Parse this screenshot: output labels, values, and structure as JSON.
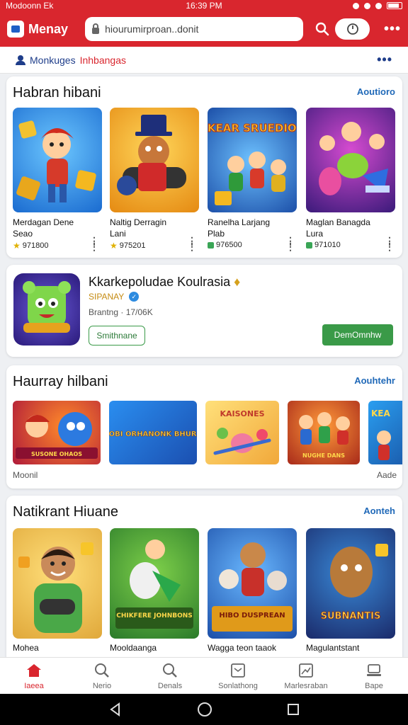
{
  "status_bar": {
    "carrier": "Modoonn Ek",
    "time": "16:39 PM"
  },
  "app_bar": {
    "logo_text": "Menay",
    "url": "hiourumirproan..donit"
  },
  "sub_bar": {
    "link_primary": "Monkuges",
    "link_secondary": "Inhbangas"
  },
  "section1": {
    "title": "Habran hibani",
    "link": "Aoutioro",
    "items": [
      {
        "line1": "Merdagan Dene",
        "line2": "Seao",
        "meta": "971800",
        "badge": "star"
      },
      {
        "line1": "Naltig Derragin",
        "line2": "Lani",
        "meta": "975201",
        "badge": "star"
      },
      {
        "line1": "Ranelha Larjang",
        "line2": "Plab",
        "meta": "976500",
        "badge": "green"
      },
      {
        "line1": "Maglan Banagda",
        "line2": "Lura",
        "meta": "971010",
        "badge": "green"
      }
    ],
    "art": [
      {
        "label": ""
      },
      {
        "label": ""
      },
      {
        "label": "EAKEAR SRUEDIORS"
      },
      {
        "label": ""
      }
    ]
  },
  "featured": {
    "title": "Kkarkepoludae Koulrasia",
    "developer": "SIPANAY",
    "stats": "Brantng · 17/06K",
    "secondary_button": "Smithnane",
    "primary_button": "DemOmnhw"
  },
  "section2": {
    "title": "Haurray hilbani",
    "link": "Aouhtehr",
    "banners": [
      {
        "text": "SUSONE OHAOS"
      },
      {
        "text": "LENOBI ORHANONK BHURDES"
      },
      {
        "text": "KAISONES"
      },
      {
        "text": "NUGHE DANS"
      },
      {
        "text": "KEA"
      }
    ],
    "footer_left": "Moonil",
    "footer_right": "Aade"
  },
  "section3": {
    "title": "Natikrant Hiuane",
    "link": "Aonteh",
    "items": [
      {
        "name": "Mohea",
        "art": ""
      },
      {
        "name": "Mooldaanga",
        "art": "CHIKFERE JOHNBONS"
      },
      {
        "name": "Wagga teon taaok",
        "art": "HIBO DUSPREAN"
      },
      {
        "name": "Magulantstant",
        "art": "SUBNANTIS"
      }
    ]
  },
  "bottom_nav": [
    {
      "label": "Iaeea",
      "icon": "home-icon"
    },
    {
      "label": "Nerio",
      "icon": "search-icon"
    },
    {
      "label": "Denals",
      "icon": "search-icon"
    },
    {
      "label": "Sonlathong",
      "icon": "image-icon"
    },
    {
      "label": "Marlesraban",
      "icon": "picture-icon"
    },
    {
      "label": "Bape",
      "icon": "laptop-icon"
    }
  ],
  "colors": {
    "brand_red": "#d9262e",
    "link_blue": "#2069b8",
    "install_green": "#3a9a48"
  }
}
